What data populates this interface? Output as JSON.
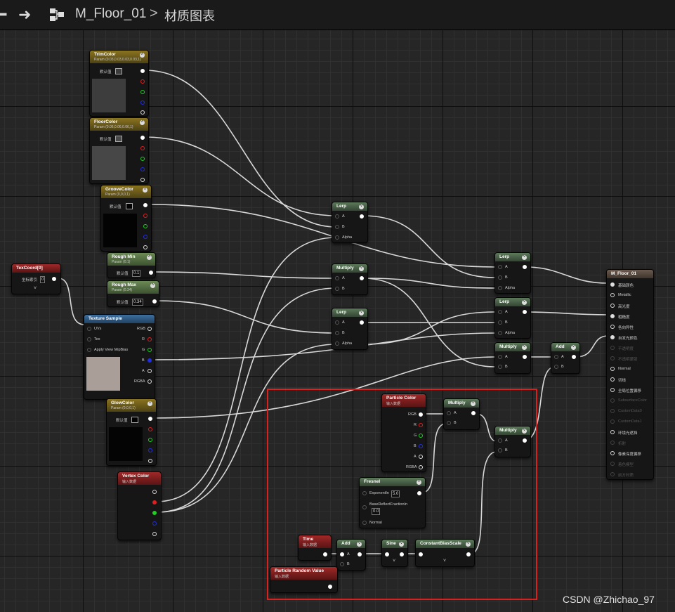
{
  "toolbar": {
    "title": "M_Floor_01",
    "separator": ">",
    "subtitle": "材质图表"
  },
  "common": {
    "default_value": "默认值",
    "input_data": "输入数据"
  },
  "nodes": {
    "trim_color": {
      "title": "TrimColor",
      "subtitle": "Param (0.03,0.03,0.03,0.03,1)"
    },
    "floor_color": {
      "title": "FloorColor",
      "subtitle": "Param (0.06,0.06,0.06,1)"
    },
    "groove_color": {
      "title": "GrooveColor",
      "subtitle": "Param (0,0,0,1)"
    },
    "rough_min": {
      "title": "Rough Min",
      "subtitle": "Param (0.1)",
      "value": "0.1"
    },
    "rough_max": {
      "title": "Rough Max",
      "subtitle": "Param (0.34)",
      "value": "0.34"
    },
    "texcoord": {
      "title": "TexCoord[0]",
      "label": "坐标索引",
      "value": "0"
    },
    "texture_sample": {
      "title": "Texture Sample",
      "inputs": [
        "UVs",
        "Tex",
        "Apply View MipBias"
      ],
      "outputs": [
        "RGB",
        "R",
        "G",
        "B",
        "A",
        "RGBA"
      ]
    },
    "glow_color": {
      "title": "GlowColor",
      "subtitle": "Param (0,0,0,1)"
    },
    "vertex_color": {
      "title": "Vertex Color"
    },
    "lerp1": {
      "title": "Lerp",
      "pins": [
        "A",
        "B",
        "Alpha"
      ]
    },
    "multiply1": {
      "title": "Multiply",
      "pins": [
        "A",
        "B"
      ]
    },
    "lerp2": {
      "title": "Lerp",
      "pins": [
        "A",
        "B",
        "Alpha"
      ]
    },
    "lerp3": {
      "title": "Lerp",
      "pins": [
        "A",
        "B",
        "Alpha"
      ]
    },
    "lerp4": {
      "title": "Lerp",
      "pins": [
        "A",
        "B",
        "Alpha"
      ]
    },
    "multiply2": {
      "title": "Multiply",
      "pins": [
        "A",
        "B"
      ]
    },
    "add1": {
      "title": "Add",
      "pins": [
        "A",
        "B"
      ]
    },
    "particle_color": {
      "title": "Particle Color",
      "outputs": [
        "RGB",
        "R",
        "G",
        "B",
        "A",
        "RGBA"
      ]
    },
    "multiply3": {
      "title": "Multiply",
      "pins": [
        "A",
        "B"
      ]
    },
    "multiply4": {
      "title": "Multiply",
      "pins": [
        "A",
        "B"
      ]
    },
    "fresnel": {
      "title": "Fresnel",
      "exponent_label": "ExponentIn",
      "exponent_value": "5.0",
      "base_label": "BaseReflectFractionIn",
      "base_value": "0.0",
      "normal_label": "Normal"
    },
    "time": {
      "title": "Time"
    },
    "add2": {
      "title": "Add",
      "pins": [
        "A",
        "B"
      ]
    },
    "sine": {
      "title": "Sine"
    },
    "constant_bias_scale": {
      "title": "ConstantBiasScale"
    },
    "particle_random": {
      "title": "Particle Random Value"
    },
    "material": {
      "title": "M_Floor_01",
      "inputs": [
        {
          "label": "基础颜色",
          "enabled": true
        },
        {
          "label": "Metallic",
          "enabled": true
        },
        {
          "label": "高光度",
          "enabled": true
        },
        {
          "label": "粗糙度",
          "enabled": true
        },
        {
          "label": "各向异性",
          "enabled": true
        },
        {
          "label": "自发光颜色",
          "enabled": true
        },
        {
          "label": "不透明度",
          "enabled": false
        },
        {
          "label": "不透明蒙版",
          "enabled": false
        },
        {
          "label": "Normal",
          "enabled": true
        },
        {
          "label": "切线",
          "enabled": true
        },
        {
          "label": "全局位置偏移",
          "enabled": true
        },
        {
          "label": "SubsurfaceColor",
          "enabled": false
        },
        {
          "label": "CustomData0",
          "enabled": false
        },
        {
          "label": "CustomData1",
          "enabled": false
        },
        {
          "label": "环境光遮挡",
          "enabled": true
        },
        {
          "label": "折射",
          "enabled": false
        },
        {
          "label": "像素深度偏移",
          "enabled": true
        },
        {
          "label": "着色模型",
          "enabled": false
        },
        {
          "label": "前方材质",
          "enabled": false
        }
      ]
    }
  },
  "watermark": "CSDN @Zhichao_97"
}
